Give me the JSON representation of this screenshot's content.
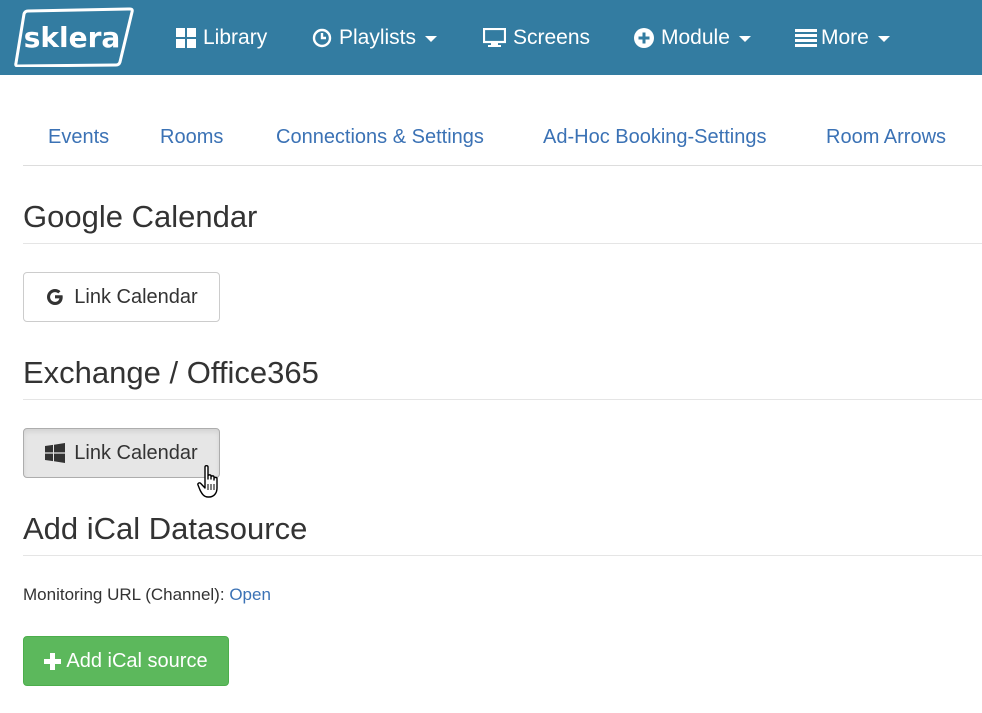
{
  "navbar": {
    "brand": "sklera",
    "items": [
      {
        "label": "Library",
        "icon": "grid-icon"
      },
      {
        "label": "Playlists",
        "icon": "clock-icon",
        "dropdown": true
      },
      {
        "label": "Screens",
        "icon": "monitor-icon"
      },
      {
        "label": "Module",
        "icon": "plus-circle-icon",
        "dropdown": true
      },
      {
        "label": "More",
        "icon": "list-icon",
        "dropdown": true
      }
    ],
    "bg_color": "#337ca1"
  },
  "tabs": [
    {
      "label": "Events"
    },
    {
      "label": "Rooms"
    },
    {
      "label": "Connections & Settings"
    },
    {
      "label": "Ad-Hoc Booking-Settings"
    },
    {
      "label": "Room Arrows"
    }
  ],
  "sections": {
    "google": {
      "title": "Google Calendar",
      "button_label": "Link Calendar",
      "button_icon": "google-icon"
    },
    "exchange": {
      "title": "Exchange / Office365",
      "button_label": "Link Calendar",
      "button_icon": "windows-icon"
    },
    "ical": {
      "title": "Add iCal Datasource",
      "monitoring_label": "Monitoring URL (Channel):",
      "monitoring_link": "Open",
      "add_button_label": "Add iCal source",
      "add_button_icon": "plus-icon",
      "add_button_color": "#5cb85c"
    }
  },
  "link_color": "#3b72b5"
}
